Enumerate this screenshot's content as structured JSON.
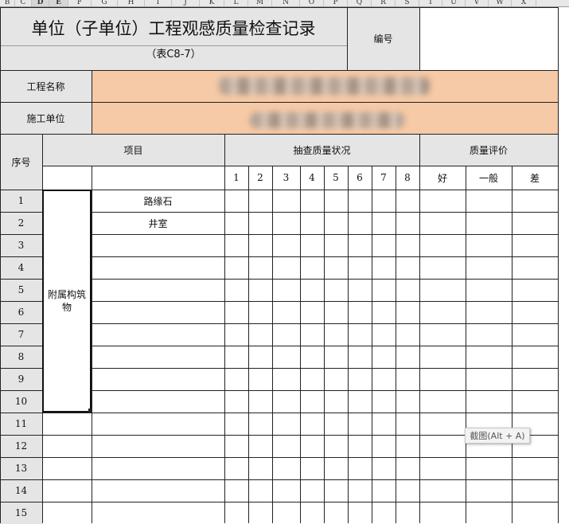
{
  "column_headers": [
    "B",
    "C",
    "D",
    "E",
    "F",
    "G",
    "H",
    "I",
    "J",
    "K",
    "L",
    "M",
    "N",
    "O",
    "P",
    "Q",
    "R",
    "S",
    "T",
    "U",
    "V",
    "W",
    "X"
  ],
  "title": "单位（子单位）工程观感质量检查记录",
  "subtitle": "（表C8-7）",
  "number_label": "编号",
  "number_value": "",
  "project_name_label": "工程名称",
  "construction_unit_label": "施工单位",
  "table": {
    "seq_header": "序号",
    "item_header": "项目",
    "inspection_header": "抽查质量状况",
    "evaluation_header": "质量评价",
    "inspection_points": [
      "1",
      "2",
      "3",
      "4",
      "5",
      "6",
      "7",
      "8"
    ],
    "evaluation_levels": [
      "好",
      "一般",
      "差"
    ],
    "group_label": "附属构筑物",
    "rows": [
      {
        "seq": "1",
        "item": "路缘石"
      },
      {
        "seq": "2",
        "item": "井室"
      },
      {
        "seq": "3",
        "item": ""
      },
      {
        "seq": "4",
        "item": ""
      },
      {
        "seq": "5",
        "item": ""
      },
      {
        "seq": "6",
        "item": ""
      },
      {
        "seq": "7",
        "item": ""
      },
      {
        "seq": "8",
        "item": ""
      },
      {
        "seq": "9",
        "item": ""
      },
      {
        "seq": "10",
        "item": ""
      },
      {
        "seq": "11",
        "item": ""
      },
      {
        "seq": "12",
        "item": ""
      },
      {
        "seq": "13",
        "item": ""
      },
      {
        "seq": "14",
        "item": ""
      },
      {
        "seq": "15",
        "item": ""
      }
    ]
  },
  "tooltip": "截图(Alt + A)"
}
